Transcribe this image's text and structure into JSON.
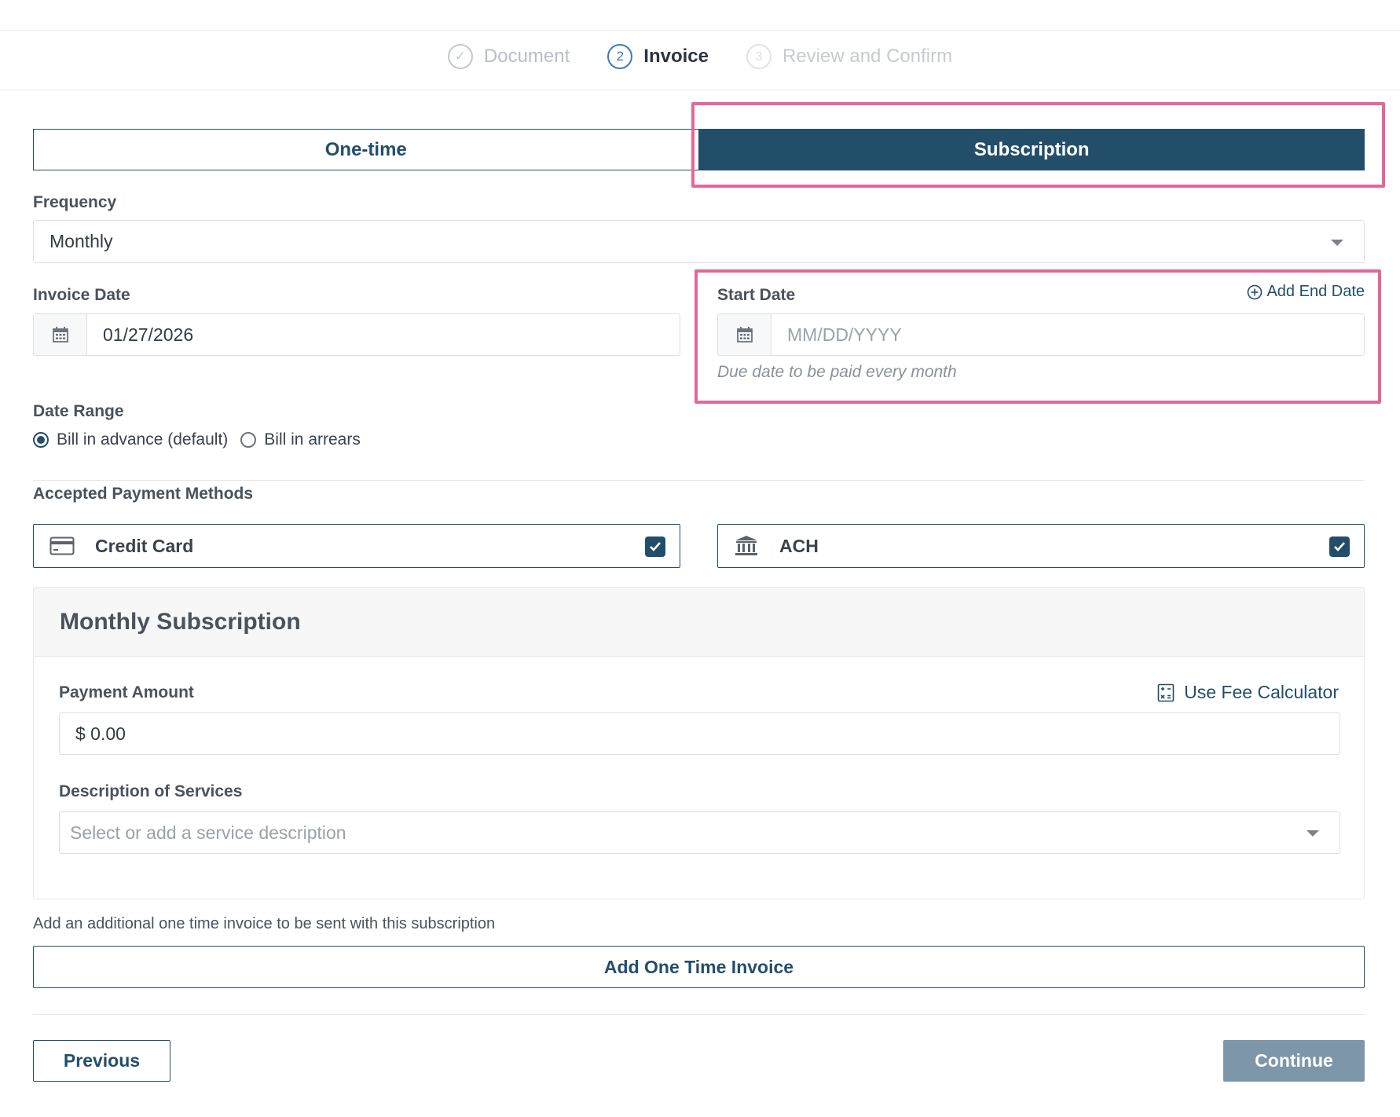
{
  "stepper": {
    "steps": [
      {
        "label": "Document",
        "marker": "✓",
        "state": "done"
      },
      {
        "label": "Invoice",
        "marker": "2",
        "state": "active"
      },
      {
        "label": "Review and Confirm",
        "marker": "3",
        "state": "future"
      }
    ]
  },
  "billing_tabs": {
    "one_time": "One-time",
    "subscription": "Subscription",
    "selected": "Subscription"
  },
  "frequency": {
    "label": "Frequency",
    "value": "Monthly"
  },
  "invoice_date": {
    "label": "Invoice Date",
    "value": "01/27/2026"
  },
  "start_date": {
    "label": "Start Date",
    "placeholder": "MM/DD/YYYY",
    "hint": "Due date to be paid every month",
    "add_end_date": "Add End Date"
  },
  "date_range": {
    "label": "Date Range",
    "options": [
      {
        "label": "Bill in advance (default)",
        "selected": true
      },
      {
        "label": "Bill in arrears",
        "selected": false
      }
    ]
  },
  "payment_methods": {
    "label": "Accepted Payment Methods",
    "items": [
      {
        "label": "Credit Card",
        "icon": "credit-card-icon",
        "checked": true
      },
      {
        "label": "ACH",
        "icon": "bank-icon",
        "checked": true
      }
    ]
  },
  "subscription_card": {
    "title": "Monthly Subscription",
    "payment_amount_label": "Payment Amount",
    "fee_calculator": "Use Fee Calculator",
    "payment_amount_value": "$ 0.00",
    "description_label": "Description of Services",
    "description_placeholder": "Select or add a service description"
  },
  "additional": {
    "note": "Add an additional one time invoice to be sent with this subscription",
    "add_button": "Add One Time Invoice"
  },
  "footer": {
    "previous": "Previous",
    "continue": "Continue"
  },
  "colors": {
    "primary": "#234e6a",
    "highlight": "#e4679a",
    "continue_disabled": "#7d96a9",
    "step_active": "#3d7bb3"
  }
}
